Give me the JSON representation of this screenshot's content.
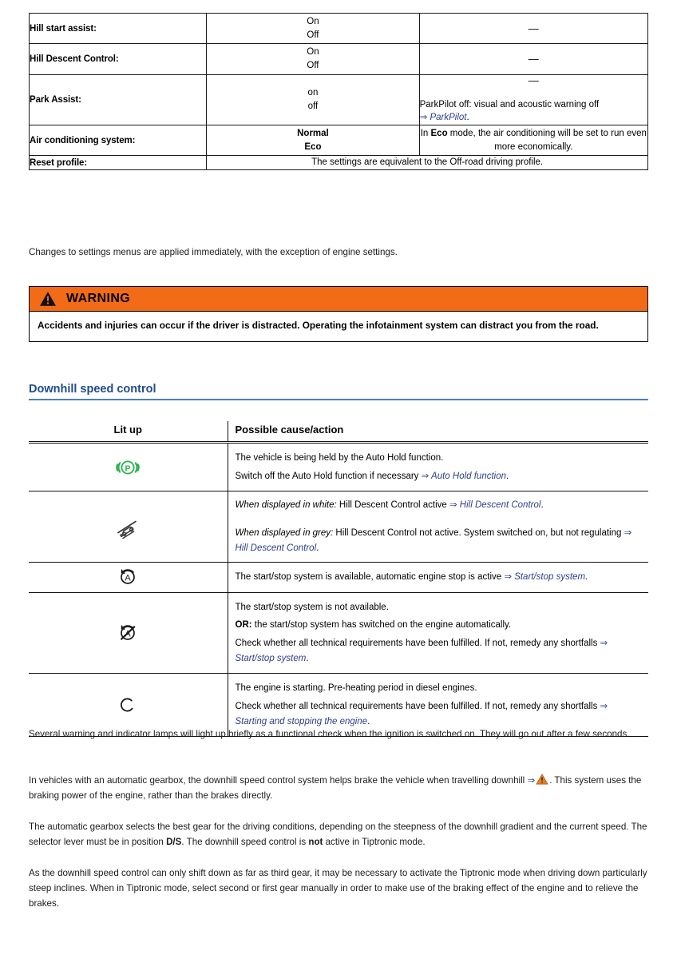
{
  "settings_table": {
    "rows": [
      {
        "label": "Hill start assist:",
        "values": [
          "On",
          "Off"
        ],
        "values_bold": false,
        "note": "—",
        "note_type": "dash"
      },
      {
        "label": "Hill Descent Control:",
        "values": [
          "On",
          "Off"
        ],
        "values_bold": false,
        "note": "—",
        "note_type": "dash"
      },
      {
        "label": "Park Assist:",
        "values": [
          "on",
          "off"
        ],
        "values_bold": false,
        "note_type": "dash_plus_text",
        "note_dash": "—",
        "note_text": "ParkPilot off: visual and acoustic warning off",
        "note_arrow": "⇒",
        "note_link": "ParkPilot",
        "note_period": "."
      },
      {
        "label": "Air conditioning system:",
        "values": [
          "Normal",
          "Eco"
        ],
        "values_bold": true,
        "note_type": "rich",
        "note_prefix": "In ",
        "note_bold": "Eco",
        "note_suffix": " mode, the air conditioning will be set to run even more economically."
      },
      {
        "label": "Reset profile:",
        "note_type": "span",
        "note_text": "The settings are equivalent to the Off-road driving profile."
      }
    ]
  },
  "intro_paragraph": "Changes to settings menus are applied immediately, with the exception of engine settings.",
  "warning": {
    "icon": "warning-triangle-icon",
    "title": "WARNING",
    "body": "Accidents and injuries can occur if the driver is distracted. Operating the infotainment system can distract you from the road.",
    "header_color": "#f26c18"
  },
  "section": {
    "title": "Downhill speed control",
    "title_color": "#1e4b8f",
    "rule_color": "#4a7fc1"
  },
  "lamps_table": {
    "headers": {
      "icon": "Lit up",
      "text": "Possible cause/action"
    },
    "rows": [
      {
        "icon": "auto-hold-parking-brake-icon",
        "icon_color": "#2bb24c",
        "lines": [
          {
            "parts": [
              {
                "t": "plain",
                "v": "The vehicle is being held by the Auto Hold function."
              }
            ]
          },
          {
            "parts": [
              {
                "t": "plain",
                "v": "Switch off the Auto Hold function if necessary "
              },
              {
                "t": "arrow",
                "v": "⇒"
              },
              {
                "t": "link",
                "v": " Auto Hold function"
              },
              {
                "t": "plain",
                "v": "."
              }
            ]
          }
        ]
      },
      {
        "icon": "hill-descent-control-icon",
        "icon_color": "#3a3a3a",
        "sub_blocks": [
          {
            "lines": [
              {
                "parts": [
                  {
                    "t": "italic",
                    "v": "When displayed in white:"
                  },
                  {
                    "t": "plain",
                    "v": " Hill Descent Control active "
                  },
                  {
                    "t": "arrow",
                    "v": "⇒"
                  },
                  {
                    "t": "link",
                    "v": " Hill Descent Control"
                  },
                  {
                    "t": "plain",
                    "v": "."
                  }
                ]
              }
            ]
          },
          {
            "lines": [
              {
                "parts": [
                  {
                    "t": "italic",
                    "v": "When displayed in grey:"
                  },
                  {
                    "t": "plain",
                    "v": " Hill Descent Control not active. System switched on, but not regulating "
                  },
                  {
                    "t": "arrow",
                    "v": "⇒"
                  },
                  {
                    "t": "link",
                    "v": " Hill Descent Control"
                  },
                  {
                    "t": "plain",
                    "v": "."
                  }
                ]
              }
            ]
          }
        ]
      },
      {
        "icon": "start-stop-available-icon",
        "icon_color": "#1a1a1a",
        "lines": [
          {
            "parts": [
              {
                "t": "plain",
                "v": "The start/stop system is available, automatic engine stop is active "
              },
              {
                "t": "arrow",
                "v": "⇒"
              },
              {
                "t": "link",
                "v": " Start/stop system"
              },
              {
                "t": "plain",
                "v": "."
              }
            ]
          }
        ]
      },
      {
        "icon": "start-stop-unavailable-icon",
        "icon_color": "#1a1a1a",
        "lines": [
          {
            "parts": [
              {
                "t": "plain",
                "v": "The start/stop system is not available."
              }
            ]
          },
          {
            "parts": [
              {
                "t": "bold",
                "v": "OR:"
              },
              {
                "t": "plain",
                "v": " the start/stop system has switched on the engine automatically."
              }
            ]
          },
          {
            "parts": [
              {
                "t": "plain",
                "v": "Check whether all technical requirements have been fulfilled. If not, remedy any shortfalls "
              },
              {
                "t": "arrow",
                "v": "⇒"
              },
              {
                "t": "link",
                "v": " Start/stop system"
              },
              {
                "t": "plain",
                "v": "."
              }
            ]
          }
        ]
      },
      {
        "icon": "engine-starting-preheat-icon",
        "icon_color": "#1a1a1a",
        "lines": [
          {
            "parts": [
              {
                "t": "plain",
                "v": "The engine is starting. Pre-heating period in diesel engines."
              }
            ]
          },
          {
            "parts": [
              {
                "t": "plain",
                "v": "Check whether all technical requirements have been fulfilled. If not, remedy any shortfalls "
              },
              {
                "t": "arrow",
                "v": "⇒"
              },
              {
                "t": "link",
                "v": " Starting and stopping the engine"
              },
              {
                "t": "plain",
                "v": "."
              }
            ]
          }
        ]
      }
    ]
  },
  "body_paragraphs": [
    {
      "id": "functional-check",
      "parts": [
        {
          "t": "plain",
          "v": "Several warning and indicator lamps will light up briefly as a functional check when the ignition is switched on. They will go out after a few seconds."
        }
      ]
    },
    {
      "id": "automatic-gearbox-downhill",
      "parts": [
        {
          "t": "plain",
          "v": "In vehicles with an automatic gearbox, the downhill speed control system helps brake the vehicle when travelling downhill "
        },
        {
          "t": "arrow",
          "v": "⇒"
        },
        {
          "t": "tri",
          "v": "warning-triangle-inline-icon"
        },
        {
          "t": "plain",
          "v": ". This system uses the braking power of the engine, rather than the brakes directly."
        }
      ]
    },
    {
      "id": "best-gear-selection",
      "parts": [
        {
          "t": "plain",
          "v": "The automatic gearbox selects the best gear for the driving conditions, depending on the steepness of the downhill gradient and the current speed. The selector lever must be in position "
        },
        {
          "t": "bold",
          "v": "D/S"
        },
        {
          "t": "plain",
          "v": ". The downhill speed control is "
        },
        {
          "t": "bold",
          "v": "not"
        },
        {
          "t": "plain",
          "v": " active in Tiptronic mode."
        }
      ]
    },
    {
      "id": "third-gear-tiptronic",
      "parts": [
        {
          "t": "plain",
          "v": "As the downhill speed control can only shift down as far as third gear, it may be necessary to activate the Tiptronic mode when driving down particularly steep inclines. When in Tiptronic mode, select second or first gear manually in order to make use of the braking effect of the engine and to relieve the brakes."
        }
      ]
    }
  ],
  "colors": {
    "xref_blue": "#2b3e8c",
    "heading_blue": "#1e4b8f",
    "rule_blue": "#4a7fc1",
    "warning_orange": "#f26c18",
    "lamp_green": "#2bb24c"
  }
}
